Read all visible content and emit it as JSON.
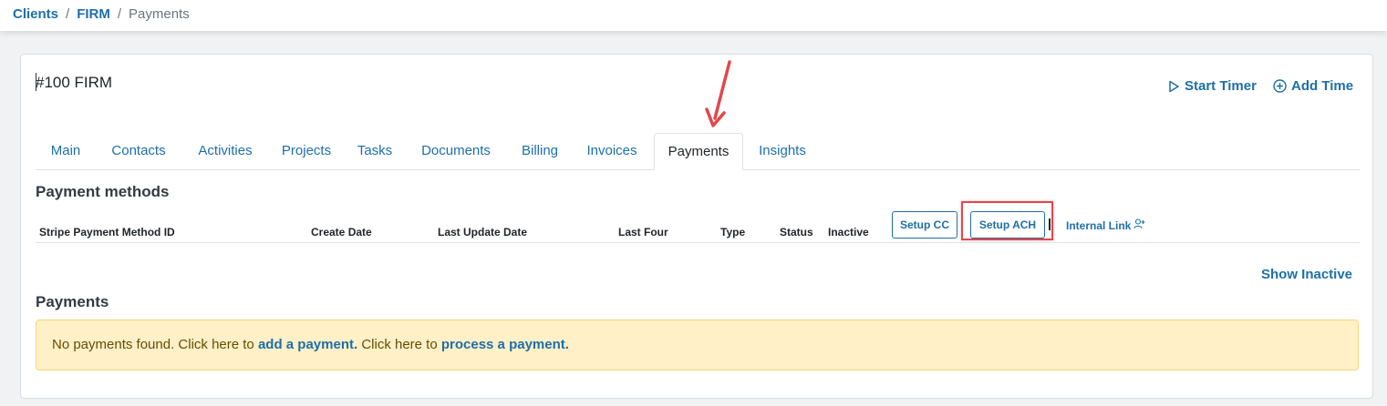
{
  "breadcrumb": {
    "items": [
      "Clients",
      "FIRM"
    ],
    "current": "Payments",
    "separator": "/"
  },
  "client": {
    "title": "#100 FIRM"
  },
  "actions": {
    "start_timer": "Start Timer",
    "add_time": "Add Time",
    "icons": [
      "play-outline-icon",
      "plus-circle-icon"
    ]
  },
  "tabs": [
    {
      "label": "Main",
      "active": false
    },
    {
      "label": "Contacts",
      "active": false
    },
    {
      "label": "Activities",
      "active": false
    },
    {
      "label": "Projects",
      "active": false
    },
    {
      "label": "Tasks",
      "active": false
    },
    {
      "label": "Documents",
      "active": false
    },
    {
      "label": "Billing",
      "active": false
    },
    {
      "label": "Invoices",
      "active": false
    },
    {
      "label": "Payments",
      "active": true
    },
    {
      "label": "Insights",
      "active": false
    }
  ],
  "payment_methods": {
    "title": "Payment methods",
    "columns": [
      "Stripe Payment Method ID",
      "Create Date",
      "Last Update Date",
      "Last Four",
      "Type",
      "Status",
      "Inactive"
    ],
    "setup_cc": "Setup CC",
    "setup_ach": "Setup ACH",
    "internal_link": "Internal Link",
    "internal_link_icon": "user-plus-icon",
    "show_inactive": "Show Inactive"
  },
  "payments": {
    "title": "Payments",
    "alert": {
      "prefix": "No payments found. Click here to ",
      "link1": "add a payment.",
      "middle": " Click here to ",
      "link2": "process a payment."
    }
  },
  "colors": {
    "link": "#1e6fa8",
    "annotation_red": "#e2474b",
    "alert_bg": "#fff0c7",
    "alert_border": "#f6d77a"
  }
}
